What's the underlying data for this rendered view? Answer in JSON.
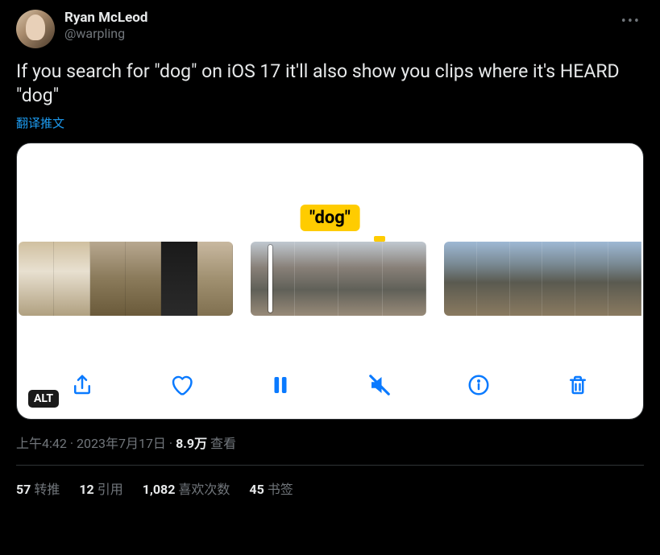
{
  "author": {
    "display_name": "Ryan McLeod",
    "handle": "@warpling"
  },
  "content": "If you search for \"dog\" on iOS 17 it'll also show you clips where it's HEARD \"dog\"",
  "translate_label": "翻译推文",
  "media": {
    "tooltip": "\"dog\"",
    "alt_badge": "ALT"
  },
  "meta": {
    "time": "上午4:42",
    "date": "2023年7月17日",
    "views_num": "8.9万",
    "views_label": "查看"
  },
  "stats": {
    "retweets_num": "57",
    "retweets_label": "转推",
    "quotes_num": "12",
    "quotes_label": "引用",
    "likes_num": "1,082",
    "likes_label": "喜欢次数",
    "bookmarks_num": "45",
    "bookmarks_label": "书签"
  }
}
